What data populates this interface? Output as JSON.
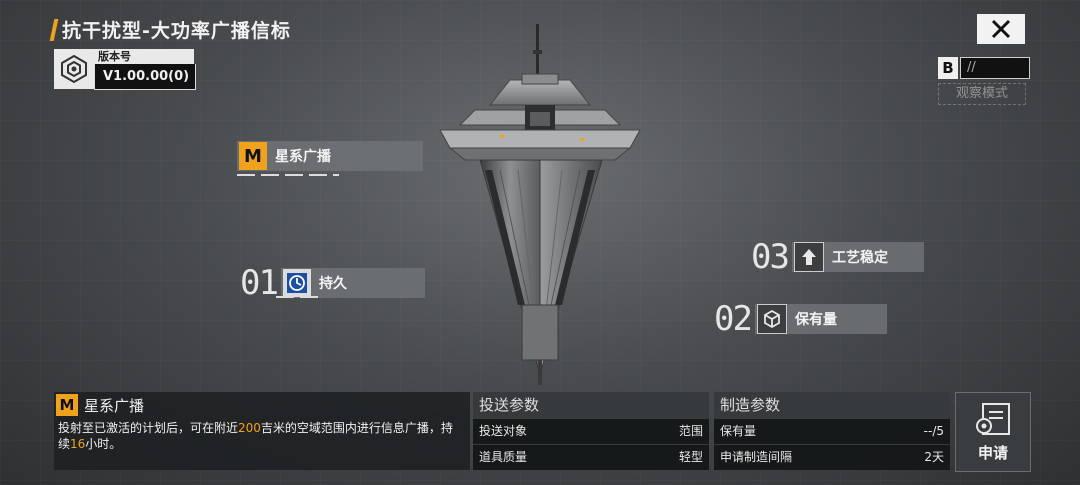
{
  "header": {
    "title": "抗干扰型-大功率广播信标",
    "version_label": "版本号",
    "version_value": "V1.00.00(0)"
  },
  "observe": {
    "key": "B",
    "field": "//",
    "mode_label": "观察模式"
  },
  "tags": {
    "main": {
      "badge": "M",
      "label": "星系广播"
    },
    "t01": {
      "num": "01",
      "label": "持久",
      "icon": "clock-icon"
    },
    "t02": {
      "num": "02",
      "label": "保有量",
      "icon": "box-icon"
    },
    "t03": {
      "num": "03",
      "label": "工艺稳定",
      "icon": "upgrade-arrow-icon"
    }
  },
  "description": {
    "badge": "M",
    "title": "星系广播",
    "text_1": "投射至已激活的计划后，可在附近",
    "highlight_1": "200",
    "text_2": "吉米的空域范围内进行信息广播，持续",
    "highlight_2": "16",
    "text_3": "小时。"
  },
  "delivery": {
    "title": "投送参数",
    "rows": [
      {
        "label": "投送对象",
        "value": "范围"
      },
      {
        "label": "道具质量",
        "value": "轻型"
      }
    ]
  },
  "manufacture": {
    "title": "制造参数",
    "rows": [
      {
        "label": "保有量",
        "value": "--/5"
      },
      {
        "label": "申请制造间隔",
        "value": "2天"
      }
    ]
  },
  "apply": {
    "label": "申请"
  },
  "colors": {
    "accent": "#f0a21c",
    "panel": "#1e2022"
  }
}
